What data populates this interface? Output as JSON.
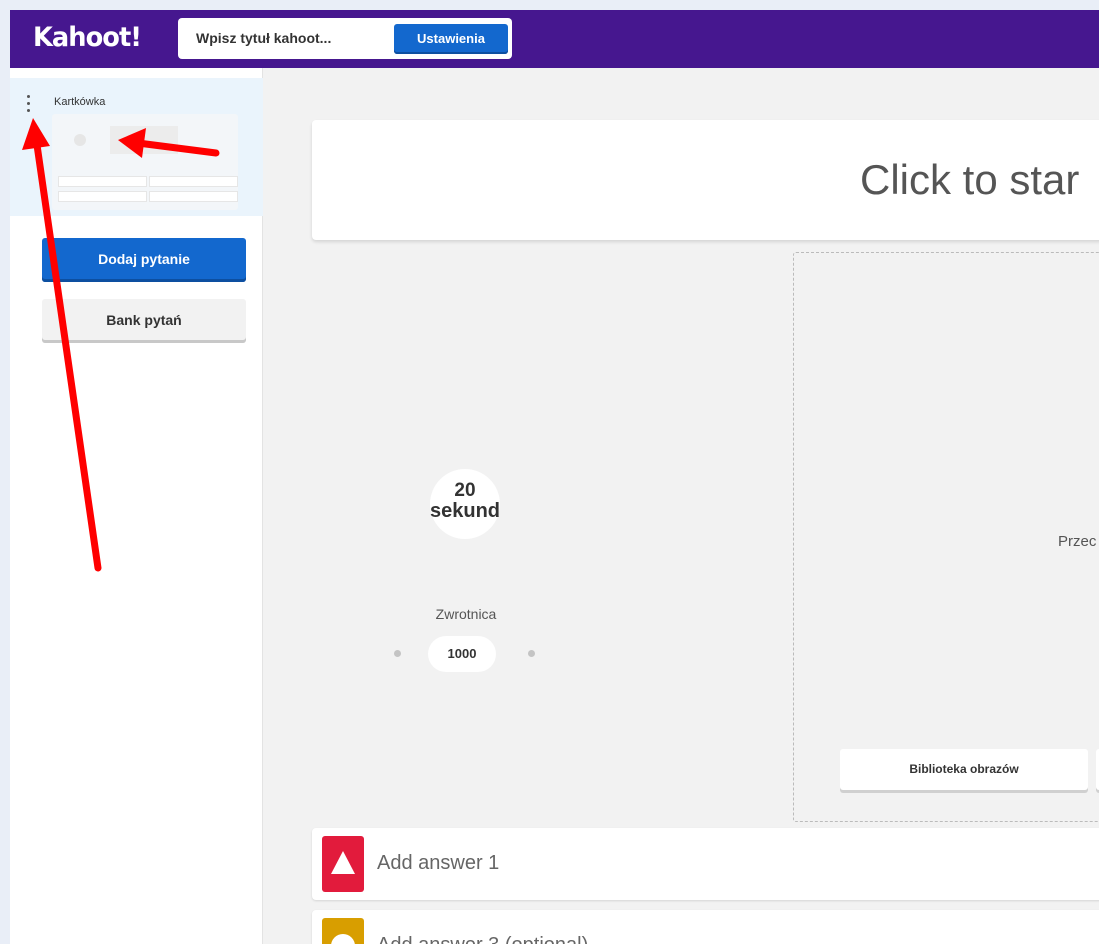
{
  "app": {
    "logo": "Kahoot!"
  },
  "topbar": {
    "title_placeholder": "Wpisz tytuł kahoot...",
    "settings_label": "Ustawienia"
  },
  "sidebar": {
    "slide_label": "Kartkówka",
    "add_question_label": "Dodaj pytanie",
    "question_bank_label": "Bank pytań"
  },
  "editor": {
    "question_placeholder": "Click to star",
    "timer_value": "20",
    "timer_unit": "sekund",
    "points_label": "Zwrotnica",
    "points_value": "1000",
    "media_hint": "Przec",
    "image_library_label": "Biblioteka obrazów",
    "answers": [
      {
        "label": "Add answer 1",
        "shape": "triangle-icon",
        "color": "#e21b3c"
      },
      {
        "label": "Add answer 3 (optional)",
        "shape": "circle-icon",
        "color": "#d89e00"
      }
    ]
  },
  "colors": {
    "topbar": "#46178f",
    "primary_button": "#1368ce",
    "annotation_arrow": "#ff0000"
  }
}
